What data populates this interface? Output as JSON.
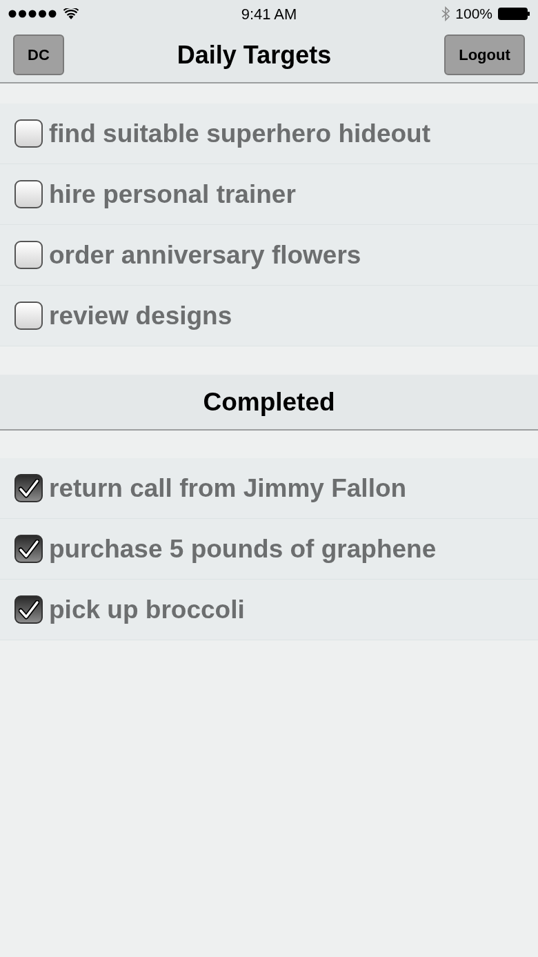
{
  "status_bar": {
    "time": "9:41 AM",
    "battery": "100%"
  },
  "nav_bar": {
    "left_button": "DC",
    "title": "Daily Targets",
    "right_button": "Logout"
  },
  "tasks": [
    {
      "label": "find suitable superhero hideout",
      "checked": false
    },
    {
      "label": "hire personal trainer",
      "checked": false
    },
    {
      "label": "order anniversary flowers",
      "checked": false
    },
    {
      "label": "review designs",
      "checked": false
    }
  ],
  "completed_section": {
    "title": "Completed",
    "tasks": [
      {
        "label": "return call from Jimmy Fallon",
        "checked": true
      },
      {
        "label": "purchase 5 pounds of graphene",
        "checked": true
      },
      {
        "label": "pick up broccoli",
        "checked": true
      }
    ]
  }
}
